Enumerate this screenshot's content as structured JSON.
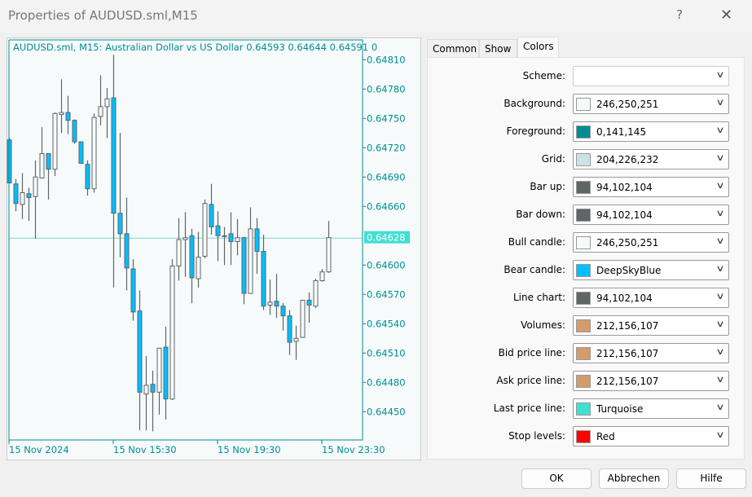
{
  "window": {
    "title": "Properties of AUDUSD.sml,M15",
    "help": "?",
    "close": "✕"
  },
  "chart": {
    "header": "AUDUSD.sml, M15:  Australian Dollar vs US Dollar  0.64593 0.64644 0.64591 0",
    "last_price_label": "0.64628",
    "colors": {
      "background": "#f6fafb",
      "foreground": "#008d91",
      "bar": "#5e6668",
      "bear": "#00bfff",
      "bull": "#f6fafb",
      "last": "#40e0d0"
    }
  },
  "chart_data": {
    "type": "candlestick",
    "ylim": [
      0.6442,
      0.6482
    ],
    "y_ticks": [
      "0.64810",
      "0.64780",
      "0.64750",
      "0.64720",
      "0.64690",
      "0.64660",
      "0.64600",
      "0.64570",
      "0.64540",
      "0.64510",
      "0.64480",
      "0.64450"
    ],
    "y_tick_values": [
      0.6481,
      0.6478,
      0.6475,
      0.6472,
      0.6469,
      0.6466,
      0.646,
      0.6457,
      0.6454,
      0.6451,
      0.6448,
      0.6445
    ],
    "x_ticks": [
      "15 Nov 2024",
      "15 Nov 15:30",
      "15 Nov 19:30",
      "15 Nov 23:30"
    ],
    "x_tick_bars": [
      0,
      16,
      32,
      48
    ],
    "last_price": 0.64628,
    "candles_ohlc": [
      [
        0.64728,
        0.6473,
        0.64684,
        0.64684
      ],
      [
        0.64683,
        0.64688,
        0.64655,
        0.64663
      ],
      [
        0.64662,
        0.64694,
        0.64647,
        0.64674
      ],
      [
        0.64673,
        0.64679,
        0.64645,
        0.64669
      ],
      [
        0.6467,
        0.64707,
        0.64627,
        0.6469
      ],
      [
        0.64689,
        0.64741,
        0.64689,
        0.64714
      ],
      [
        0.64714,
        0.64714,
        0.64667,
        0.64698
      ],
      [
        0.64698,
        0.64756,
        0.64691,
        0.64755
      ],
      [
        0.64754,
        0.6479,
        0.64735,
        0.64756
      ],
      [
        0.64756,
        0.64773,
        0.64734,
        0.64748
      ],
      [
        0.64748,
        0.64749,
        0.64724,
        0.64726
      ],
      [
        0.64726,
        0.64726,
        0.64704,
        0.64704
      ],
      [
        0.64703,
        0.64707,
        0.64671,
        0.64678
      ],
      [
        0.64678,
        0.64755,
        0.64674,
        0.64751
      ],
      [
        0.64752,
        0.64794,
        0.64743,
        0.64762
      ],
      [
        0.64762,
        0.64781,
        0.6473,
        0.6477
      ],
      [
        0.64771,
        0.64815,
        0.64577,
        0.64653
      ],
      [
        0.64653,
        0.64735,
        0.64608,
        0.64632
      ],
      [
        0.64632,
        0.64669,
        0.64574,
        0.64597
      ],
      [
        0.64596,
        0.64606,
        0.64543,
        0.64552
      ],
      [
        0.64553,
        0.64574,
        0.64431,
        0.6447
      ],
      [
        0.64468,
        0.64507,
        0.64431,
        0.64477
      ],
      [
        0.64478,
        0.64492,
        0.6443,
        0.6447
      ],
      [
        0.6447,
        0.64515,
        0.64447,
        0.64515
      ],
      [
        0.64516,
        0.64537,
        0.64442,
        0.64463
      ],
      [
        0.64463,
        0.64606,
        0.64462,
        0.64599
      ],
      [
        0.64599,
        0.64648,
        0.64584,
        0.64626
      ],
      [
        0.64626,
        0.64654,
        0.64588,
        0.64628
      ],
      [
        0.6463,
        0.64637,
        0.64561,
        0.64587
      ],
      [
        0.64586,
        0.64634,
        0.64577,
        0.64608
      ],
      [
        0.64609,
        0.64667,
        0.64607,
        0.64663
      ],
      [
        0.64662,
        0.64683,
        0.64631,
        0.64639
      ],
      [
        0.6464,
        0.64655,
        0.64604,
        0.6463
      ],
      [
        0.6463,
        0.64639,
        0.646,
        0.6463
      ],
      [
        0.64632,
        0.64654,
        0.646,
        0.64624
      ],
      [
        0.64624,
        0.64647,
        0.6461,
        0.64628
      ],
      [
        0.64628,
        0.64629,
        0.6456,
        0.64571
      ],
      [
        0.64571,
        0.64659,
        0.64571,
        0.64637
      ],
      [
        0.64637,
        0.64648,
        0.64591,
        0.64614
      ],
      [
        0.64614,
        0.64631,
        0.64554,
        0.64558
      ],
      [
        0.64559,
        0.64585,
        0.64549,
        0.64562
      ],
      [
        0.64563,
        0.64591,
        0.64546,
        0.64558
      ],
      [
        0.64558,
        0.64561,
        0.64533,
        0.64548
      ],
      [
        0.64548,
        0.64554,
        0.64508,
        0.64521
      ],
      [
        0.64522,
        0.64538,
        0.64503,
        0.64525
      ],
      [
        0.64526,
        0.64564,
        0.64526,
        0.64564
      ],
      [
        0.64564,
        0.64572,
        0.64541,
        0.64559
      ],
      [
        0.64558,
        0.64586,
        0.64556,
        0.64584
      ],
      [
        0.64584,
        0.64596,
        0.64583,
        0.64593
      ],
      [
        0.64593,
        0.64645,
        0.64592,
        0.64628
      ]
    ]
  },
  "tabs": [
    {
      "label": "Common"
    },
    {
      "label": "Show"
    },
    {
      "label": "Colors",
      "selected": true
    }
  ],
  "colors_tab": {
    "rows": [
      {
        "label": "Scheme:",
        "value": "",
        "swatch": null
      },
      {
        "label": "Background:",
        "value": "246,250,251",
        "swatch": "#f6fafb"
      },
      {
        "label": "Foreground:",
        "value": "0,141,145",
        "swatch": "#008d91"
      },
      {
        "label": "Grid:",
        "value": "204,226,232",
        "swatch": "#cce2e8"
      },
      {
        "label": "Bar up:",
        "value": "94,102,104",
        "swatch": "#5e6668"
      },
      {
        "label": "Bar down:",
        "value": "94,102,104",
        "swatch": "#5e6668"
      },
      {
        "label": "Bull candle:",
        "value": "246,250,251",
        "swatch": "#f6fafb"
      },
      {
        "label": "Bear candle:",
        "value": "DeepSkyBlue",
        "swatch": "#00bfff"
      },
      {
        "label": "Line chart:",
        "value": "94,102,104",
        "swatch": "#5e6668"
      },
      {
        "label": "Volumes:",
        "value": "212,156,107",
        "swatch": "#d49c6b"
      },
      {
        "label": "Bid price line:",
        "value": "212,156,107",
        "swatch": "#d49c6b"
      },
      {
        "label": "Ask price line:",
        "value": "212,156,107",
        "swatch": "#d49c6b"
      },
      {
        "label": "Last price line:",
        "value": "Turquoise",
        "swatch": "#40e0d0"
      },
      {
        "label": "Stop levels:",
        "value": "Red",
        "swatch": "#ff0000"
      }
    ]
  },
  "buttons": {
    "ok": "OK",
    "cancel": "Abbrechen",
    "help": "Hilfe"
  }
}
